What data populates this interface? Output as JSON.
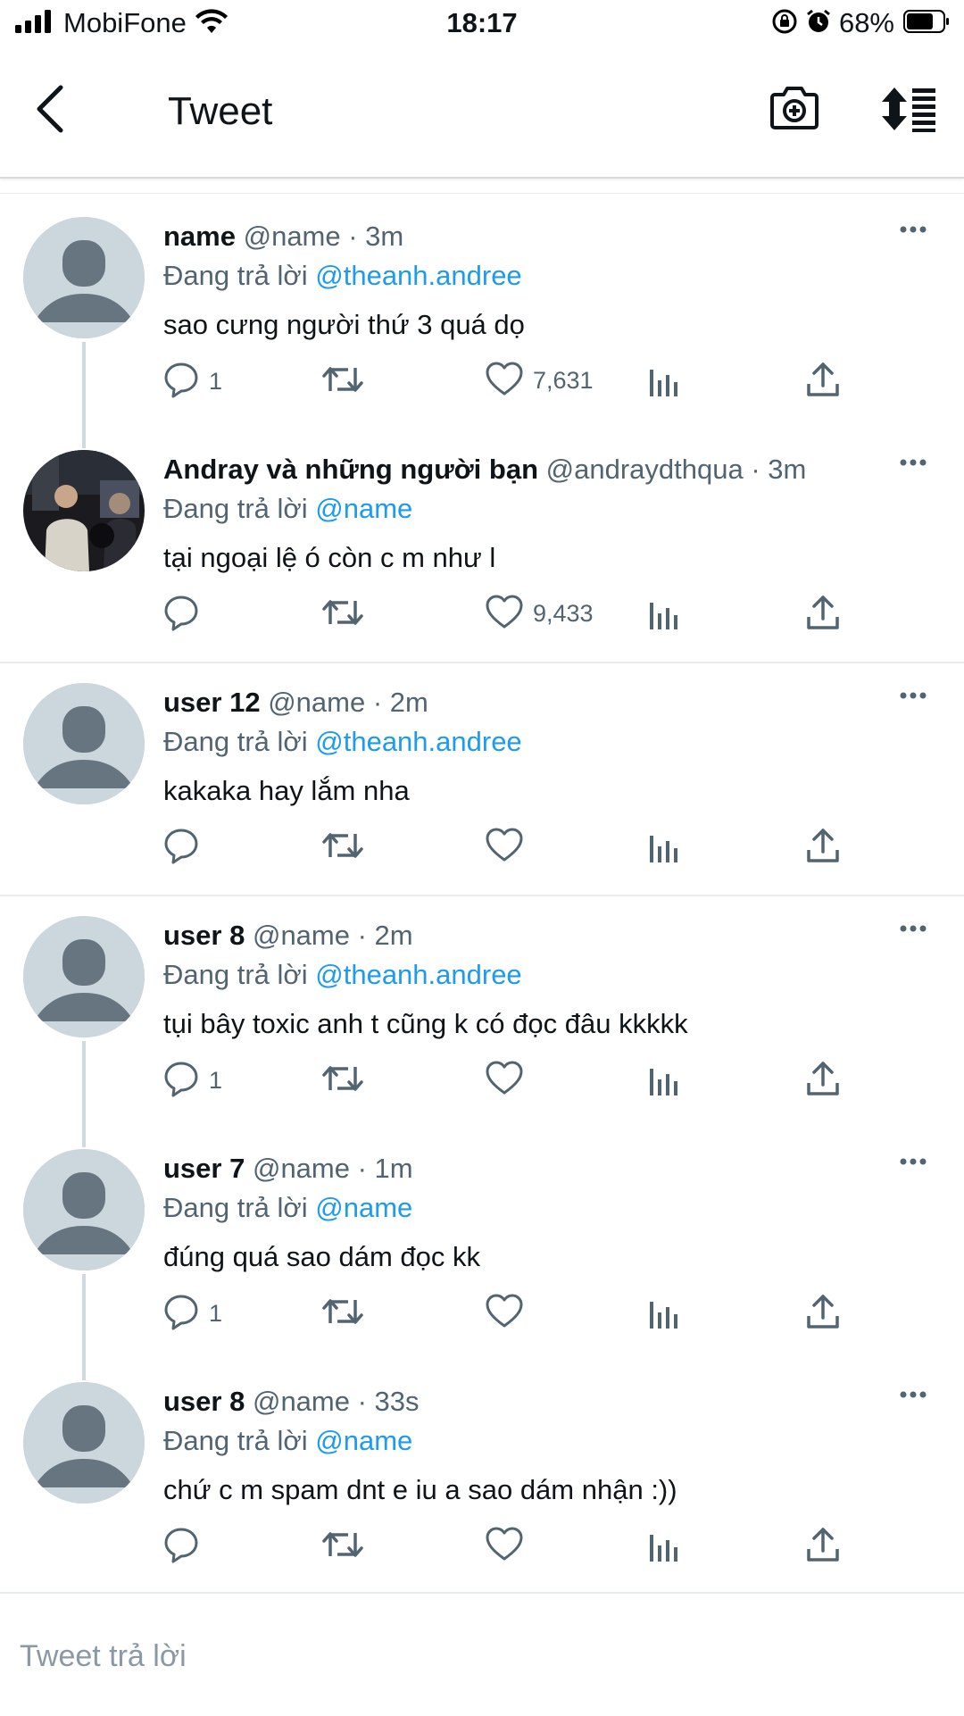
{
  "status_bar": {
    "carrier": "MobiFone",
    "time": "18:17",
    "battery": "68%"
  },
  "nav": {
    "title": "Tweet"
  },
  "tweets": [
    {
      "name": "name",
      "meta": "@name · 3m",
      "replying_prefix": "Đang trả lời",
      "mention": "@theanh.andree",
      "text": "sao cưng người thứ 3 quá dọ",
      "replies": "1",
      "likes": "7,631"
    },
    {
      "name": "Andray và những người bạn",
      "meta": "@andraydthqua · 3m",
      "replying_prefix": "Đang trả lời",
      "mention": "@name",
      "text": "tại ngoại lệ ó còn c m như l",
      "replies": "",
      "likes": "9,433"
    },
    {
      "name": "user 12",
      "meta": "@name · 2m",
      "replying_prefix": "Đang trả lời",
      "mention": "@theanh.andree",
      "text": "kakaka hay lắm nha",
      "replies": "",
      "likes": ""
    },
    {
      "name": "user 8",
      "meta": "@name · 2m",
      "replying_prefix": "Đang trả lời",
      "mention": "@theanh.andree",
      "text": "tụi bây toxic anh t cũng k có đọc đâu kkkkk",
      "replies": "1",
      "likes": ""
    },
    {
      "name": "user 7",
      "meta": "@name · 1m",
      "replying_prefix": "Đang trả lời",
      "mention": "@name",
      "text": "đúng quá sao dám đọc kk",
      "replies": "1",
      "likes": ""
    },
    {
      "name": "user 8",
      "meta": "@name · 33s",
      "replying_prefix": "Đang trả lời",
      "mention": "@name",
      "text": "chứ c m spam dnt e iu a sao dám nhận :))",
      "replies": "",
      "likes": ""
    }
  ],
  "reply_box": {
    "placeholder": "Tweet trả lời"
  },
  "colors": {
    "accent": "#1d9bf0",
    "secondary_text": "#536471",
    "avatar_placeholder": "#ccd6dd"
  }
}
